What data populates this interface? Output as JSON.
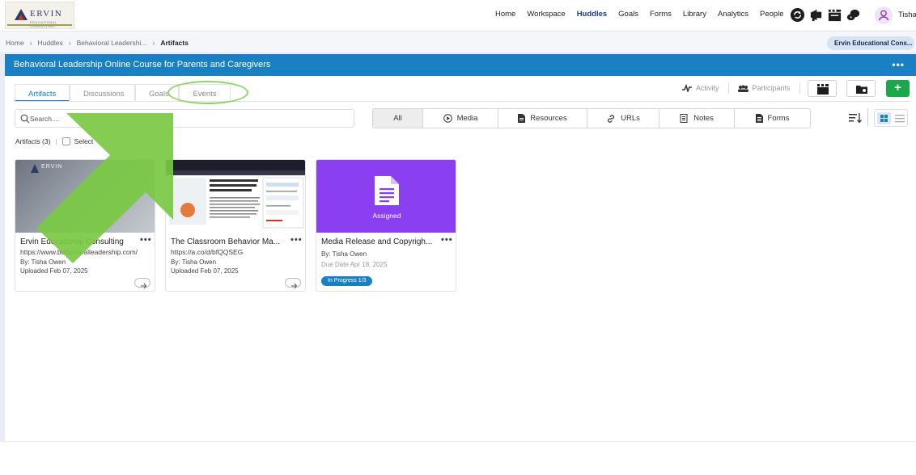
{
  "brand": {
    "logo_text": "ERVIN",
    "logo_tagline": "EDUCATIONAL CONSULTING"
  },
  "nav": {
    "items": [
      "Home",
      "Workspace",
      "Huddles",
      "Goals",
      "Forms",
      "Library",
      "Analytics",
      "People"
    ],
    "active": "Huddles",
    "icons": [
      "refresh-icon",
      "megaphone-icon",
      "clapperboard-icon",
      "chat-bubbles-icon"
    ],
    "user_name": "Tisha"
  },
  "breadcrumb": {
    "items": [
      "Home",
      "Huddles",
      "Behavioral Leadershi...",
      "Artifacts"
    ],
    "org_pill": "Ervin Educational Cons..."
  },
  "huddle": {
    "title": "Behavioral Leadership Online Course for Parents and Caregivers",
    "more_label": "•••"
  },
  "tabs": [
    {
      "label": "Artifacts",
      "active": true
    },
    {
      "label": "Discussions",
      "active": false
    },
    {
      "label": "Goals",
      "active": false
    },
    {
      "label": "Events",
      "active": false
    }
  ],
  "tools": {
    "activity_label": "Activity",
    "participants_label": "Participants",
    "add_label": "+"
  },
  "search": {
    "placeholder": "Search....",
    "value": ""
  },
  "filters": [
    {
      "label": "All",
      "icon": "",
      "active": true
    },
    {
      "label": "Media",
      "icon": "play-icon",
      "active": false
    },
    {
      "label": "Resources",
      "icon": "document-icon",
      "active": false
    },
    {
      "label": "URLs",
      "icon": "link-icon",
      "active": false
    },
    {
      "label": "Notes",
      "icon": "notes-icon",
      "active": false
    },
    {
      "label": "Forms",
      "icon": "form-icon",
      "active": false
    }
  ],
  "artifacts": {
    "count_label": "Artifacts (3)",
    "select_label": "Select",
    "cards": [
      {
        "title": "Ervin Educational Consulting",
        "line2": "https://www.behavioralleadership.com/",
        "line3": "By: Tisha Owen",
        "line4": "Uploaded Feb 07, 2025",
        "thumb_logo": "ERVIN"
      },
      {
        "title": "The Classroom Behavior Ma...",
        "line2": "https://a.co/d/bfQQSEG",
        "line3": "By: Tisha Owen",
        "line4": "Uploaded Feb 07, 2025"
      },
      {
        "title": "Media Release and Copyrigh...",
        "line2": "By: Tisha Owen",
        "line3": "Due Date  Apr 18, 2025",
        "thumb_label": "Assigned",
        "badge": "In Progress 1/3"
      }
    ]
  },
  "colors": {
    "primary": "#1a80c4",
    "add_button": "#1aa84a",
    "assigned_thumb": "#8a3ff0",
    "annotation_arrow": "#7ac943",
    "active_nav": "#1a3a86"
  }
}
